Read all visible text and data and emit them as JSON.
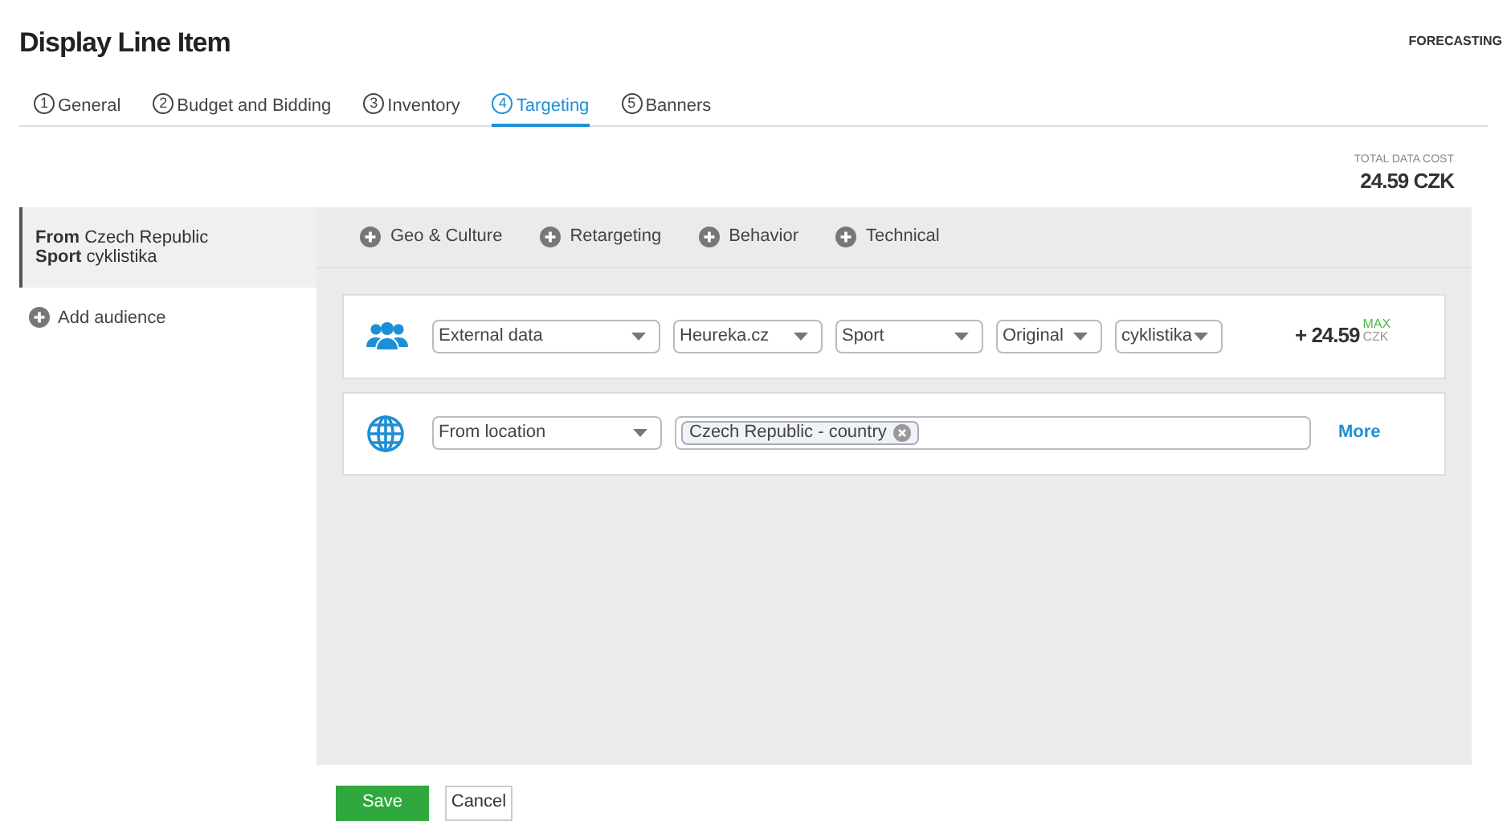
{
  "title": "Display Line Item",
  "forecasting": "FORECASTING",
  "tabs": [
    {
      "number": "1",
      "label": "General",
      "selected": false
    },
    {
      "number": "2",
      "label": "Budget and Bidding",
      "selected": false
    },
    {
      "number": "3",
      "label": "Inventory",
      "selected": false
    },
    {
      "number": "4",
      "label": "Targeting",
      "selected": true
    },
    {
      "number": "5",
      "label": "Banners",
      "selected": false
    }
  ],
  "total": {
    "label": "TOTAL DATA COST",
    "value": "24.59 CZK"
  },
  "audiences": [
    {
      "selected": true,
      "lines": [
        {
          "key": "From",
          "value": "Czech Republic"
        },
        {
          "key": "Sport",
          "value": "cyklistika"
        }
      ]
    }
  ],
  "add_audience": "Add audience",
  "categories": [
    "Geo & Culture",
    "Retargeting",
    "Behavior",
    "Technical"
  ],
  "rules": [
    {
      "kind": "data",
      "selects": [
        "External data",
        "Heureka.cz",
        "Sport",
        "Original",
        "cyklistika"
      ],
      "price": "+ 24.59",
      "max": "MAX",
      "currency": "CZK"
    },
    {
      "kind": "location",
      "select": "From location",
      "tags": [
        "Czech Republic - country"
      ],
      "link": "More"
    }
  ],
  "buttons": {
    "save": "Save",
    "cancel": "Cancel"
  }
}
